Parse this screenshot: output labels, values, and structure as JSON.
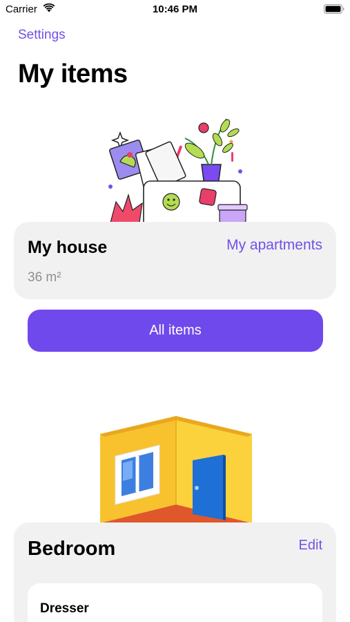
{
  "status_bar": {
    "carrier": "Carrier",
    "time": "10:46 PM"
  },
  "nav": {
    "back_label": "Settings"
  },
  "page": {
    "title": "My items"
  },
  "house": {
    "name": "My house",
    "area": "36 m²",
    "apartments_link": "My apartments"
  },
  "actions": {
    "all_items_label": "All items"
  },
  "room": {
    "name": "Bedroom",
    "edit_label": "Edit",
    "items": [
      {
        "name": "Dresser"
      }
    ]
  },
  "colors": {
    "accent": "#7150e6",
    "button": "#7049ec",
    "card_background": "#f1f1f2"
  },
  "icons": [
    "wifi-icon",
    "battery-icon",
    "house-items-illustration",
    "room-illustration"
  ]
}
